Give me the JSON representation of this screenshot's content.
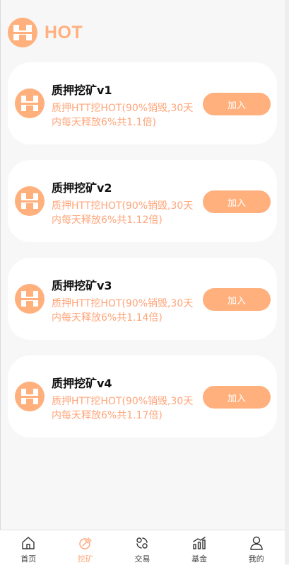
{
  "header": {
    "brand": "HOT",
    "logo_icon": "hot-logo-icon"
  },
  "accent_color": "#ffb07c",
  "cards": [
    {
      "title": "质押挖矿v1",
      "desc": "质押HTT挖HOT(90%销毁,30天内每天释放6%共1.1倍)",
      "button": "加入"
    },
    {
      "title": "质押挖矿v2",
      "desc": "质押HTT挖HOT(90%销毁,30天内每天释放6%共1.12倍)",
      "button": "加入"
    },
    {
      "title": "质押挖矿v3",
      "desc": "质押HTT挖HOT(90%销毁,30天内每天释放6%共1.14倍)",
      "button": "加入"
    },
    {
      "title": "质押挖矿v4",
      "desc": "质押HTT挖HOT(90%销毁,30天内每天释放6%共1.17倍)",
      "button": "加入"
    }
  ],
  "tabbar": {
    "active_index": 1,
    "tabs": [
      {
        "label": "首页",
        "icon": "home-icon"
      },
      {
        "label": "挖矿",
        "icon": "mining-icon"
      },
      {
        "label": "交易",
        "icon": "exchange-icon"
      },
      {
        "label": "基金",
        "icon": "fund-chart-icon"
      },
      {
        "label": "我的",
        "icon": "user-icon"
      }
    ]
  }
}
